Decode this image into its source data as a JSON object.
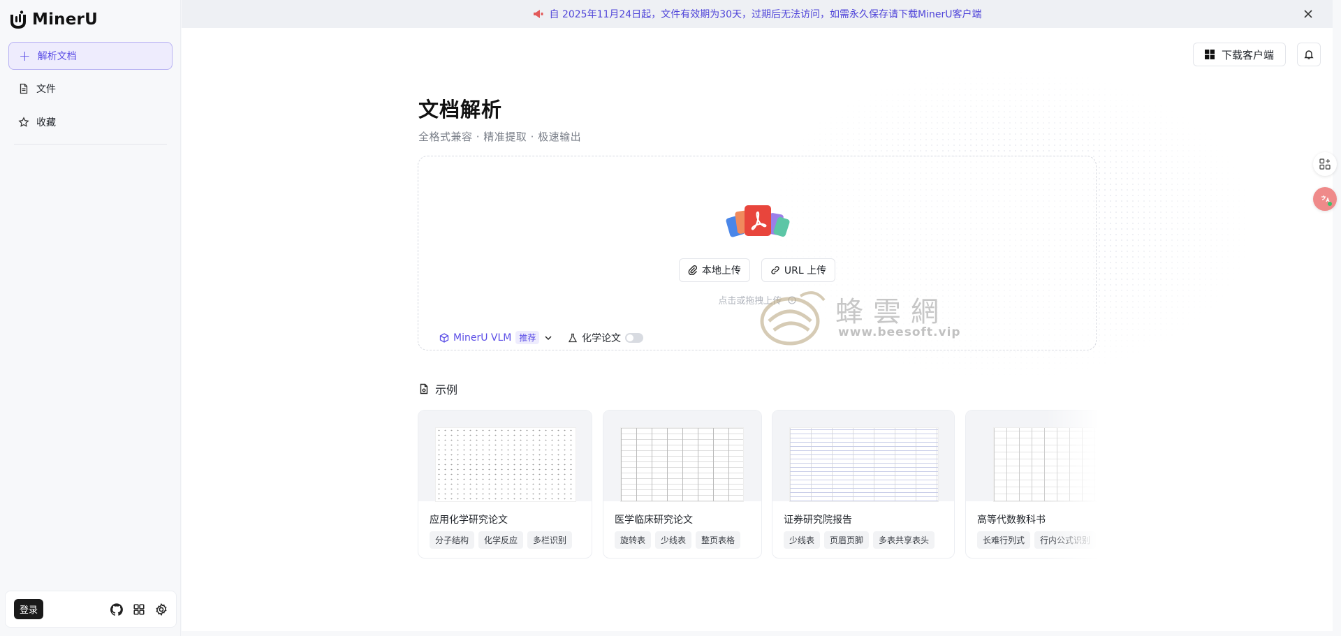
{
  "app": {
    "name": "MinerU"
  },
  "sidebar": {
    "new_label": "解析文档",
    "items": [
      {
        "label": "文件"
      },
      {
        "label": "收藏"
      }
    ],
    "login_label": "登录"
  },
  "banner": {
    "text": "自 2025年11月24日起，文件有效期为30天，过期后无法访问，如需永久保存请下载MinerU客户端"
  },
  "header": {
    "download_label": "下载客户端"
  },
  "main": {
    "title": "文档解析",
    "subtitle": "全格式兼容 · 精准提取 · 极速输出",
    "upload": {
      "local_label": "本地上传",
      "url_label": "URL 上传",
      "hint": "点击或拖拽上传"
    },
    "model": {
      "name": "MinerU VLM",
      "tag": "推荐"
    },
    "chem_label": "化学论文",
    "chem_enabled": false
  },
  "watermark": {
    "cn": "蜂雲網",
    "en": "www.beesoft.vip"
  },
  "examples": {
    "heading": "示例",
    "cards": [
      {
        "title": "应用化学研究论文",
        "tags": [
          "分子结构",
          "化学反应",
          "多栏识别"
        ]
      },
      {
        "title": "医学临床研究论文",
        "tags": [
          "旋转表",
          "少线表",
          "整页表格"
        ]
      },
      {
        "title": "证券研究院报告",
        "tags": [
          "少线表",
          "页眉页脚",
          "多表共享表头"
        ]
      },
      {
        "title": "高等代数教科书",
        "tags": [
          "长难行列式",
          "行内公式识别"
        ]
      }
    ]
  },
  "colors": {
    "accent": "#5b4ee6",
    "banner_bg": "#eef0f4"
  }
}
